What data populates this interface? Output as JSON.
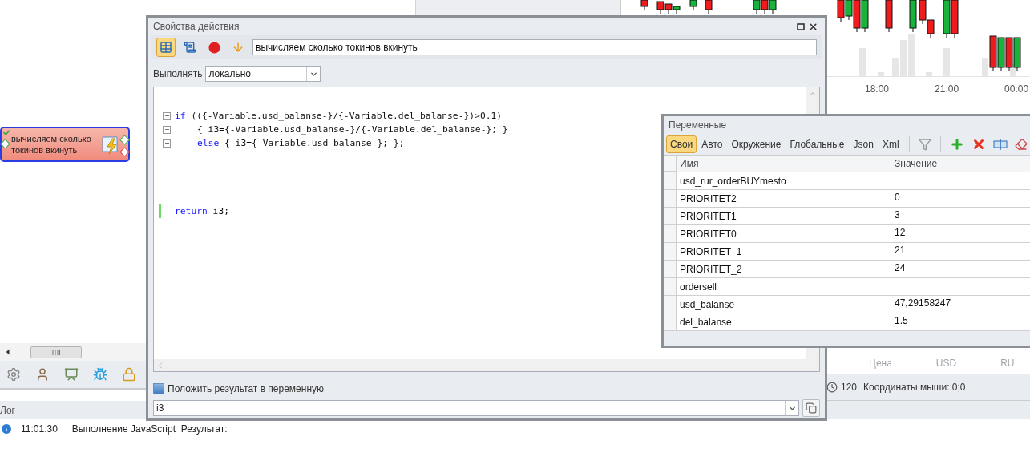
{
  "canvas": {
    "node": {
      "title": "вычисляем сколько токинов вкинуть",
      "checked": true
    }
  },
  "chart": {
    "time_labels": [
      "18:00",
      "21:00",
      "00:00"
    ]
  },
  "quotes_table": {
    "columns": [
      "Цена",
      "USD",
      "RU"
    ]
  },
  "status_bar": {
    "zoom": "120",
    "mouse_coords": "Координаты мыши: 0;0"
  },
  "log": {
    "title": "Лог",
    "entries": [
      {
        "time": "11:01:30",
        "message": "Выполнение JavaScript  Результат:"
      }
    ]
  },
  "action_dialog": {
    "title": "Свойства действия",
    "tools": [
      {
        "kind": "table",
        "selected": true
      },
      {
        "kind": "script",
        "selected": false
      },
      {
        "kind": "record",
        "selected": false
      },
      {
        "kind": "down",
        "selected": false
      }
    ],
    "name_value": "вычисляем сколько токинов вкинуть",
    "run_label": "Выполнять",
    "run_value": "локально",
    "code_lines": [
      {
        "kind": "blank"
      },
      {
        "kind": "code",
        "fold": true,
        "modified": false,
        "indented": false,
        "segments": [
          {
            "kind": "keyword",
            "text": "if"
          },
          {
            "kind": "plain",
            "text": " (({-Variable.usd_balanse-}/{-Variable.del_balanse-})>0.1)"
          }
        ]
      },
      {
        "kind": "code",
        "fold": true,
        "modified": false,
        "indented": true,
        "segments": [
          {
            "kind": "plain",
            "text": "{ i3={-Variable.usd_balanse-}/{-Variable.del_balanse-}; }"
          }
        ]
      },
      {
        "kind": "code",
        "fold": true,
        "modified": false,
        "indented": true,
        "segments": [
          {
            "kind": "keyword",
            "text": "else"
          },
          {
            "kind": "plain",
            "text": " { i3={-Variable.usd_balanse-}; };"
          }
        ]
      },
      {
        "kind": "blank"
      },
      {
        "kind": "blank"
      },
      {
        "kind": "blank"
      },
      {
        "kind": "blank"
      },
      {
        "kind": "code",
        "fold": false,
        "modified": true,
        "indented": false,
        "segments": [
          {
            "kind": "keyword",
            "text": "return"
          },
          {
            "kind": "plain",
            "text": " i3;"
          }
        ]
      }
    ],
    "save_result": {
      "label": "Положить результат в переменную",
      "checked": true
    },
    "result_variable": "i3"
  },
  "variables_window": {
    "title": "Переменные",
    "tabs": [
      {
        "label": "Свои",
        "selected": true
      },
      {
        "label": "Авто",
        "selected": false
      },
      {
        "label": "Окружение",
        "selected": false
      },
      {
        "label": "Глобальные",
        "selected": false
      },
      {
        "label": "Json",
        "selected": false
      },
      {
        "label": "Xml",
        "selected": false
      }
    ],
    "columns": [
      "Имя",
      "Значение"
    ],
    "rows": [
      {
        "name": "usd_rur_orderBUYmesto"
      },
      {
        "name": "PRIORITET2",
        "value": "0"
      },
      {
        "name": "PRIORITET1",
        "value": "3"
      },
      {
        "name": "PRIORITET0",
        "value": "12"
      },
      {
        "name": "PRIORITET_1",
        "value": "21"
      },
      {
        "name": "PRIORITET_2",
        "value": "24"
      },
      {
        "name": "ordersell"
      },
      {
        "name": "usd_balanse",
        "value": "47,29158247"
      },
      {
        "name": "del_balanse",
        "value": "1.5"
      }
    ]
  }
}
